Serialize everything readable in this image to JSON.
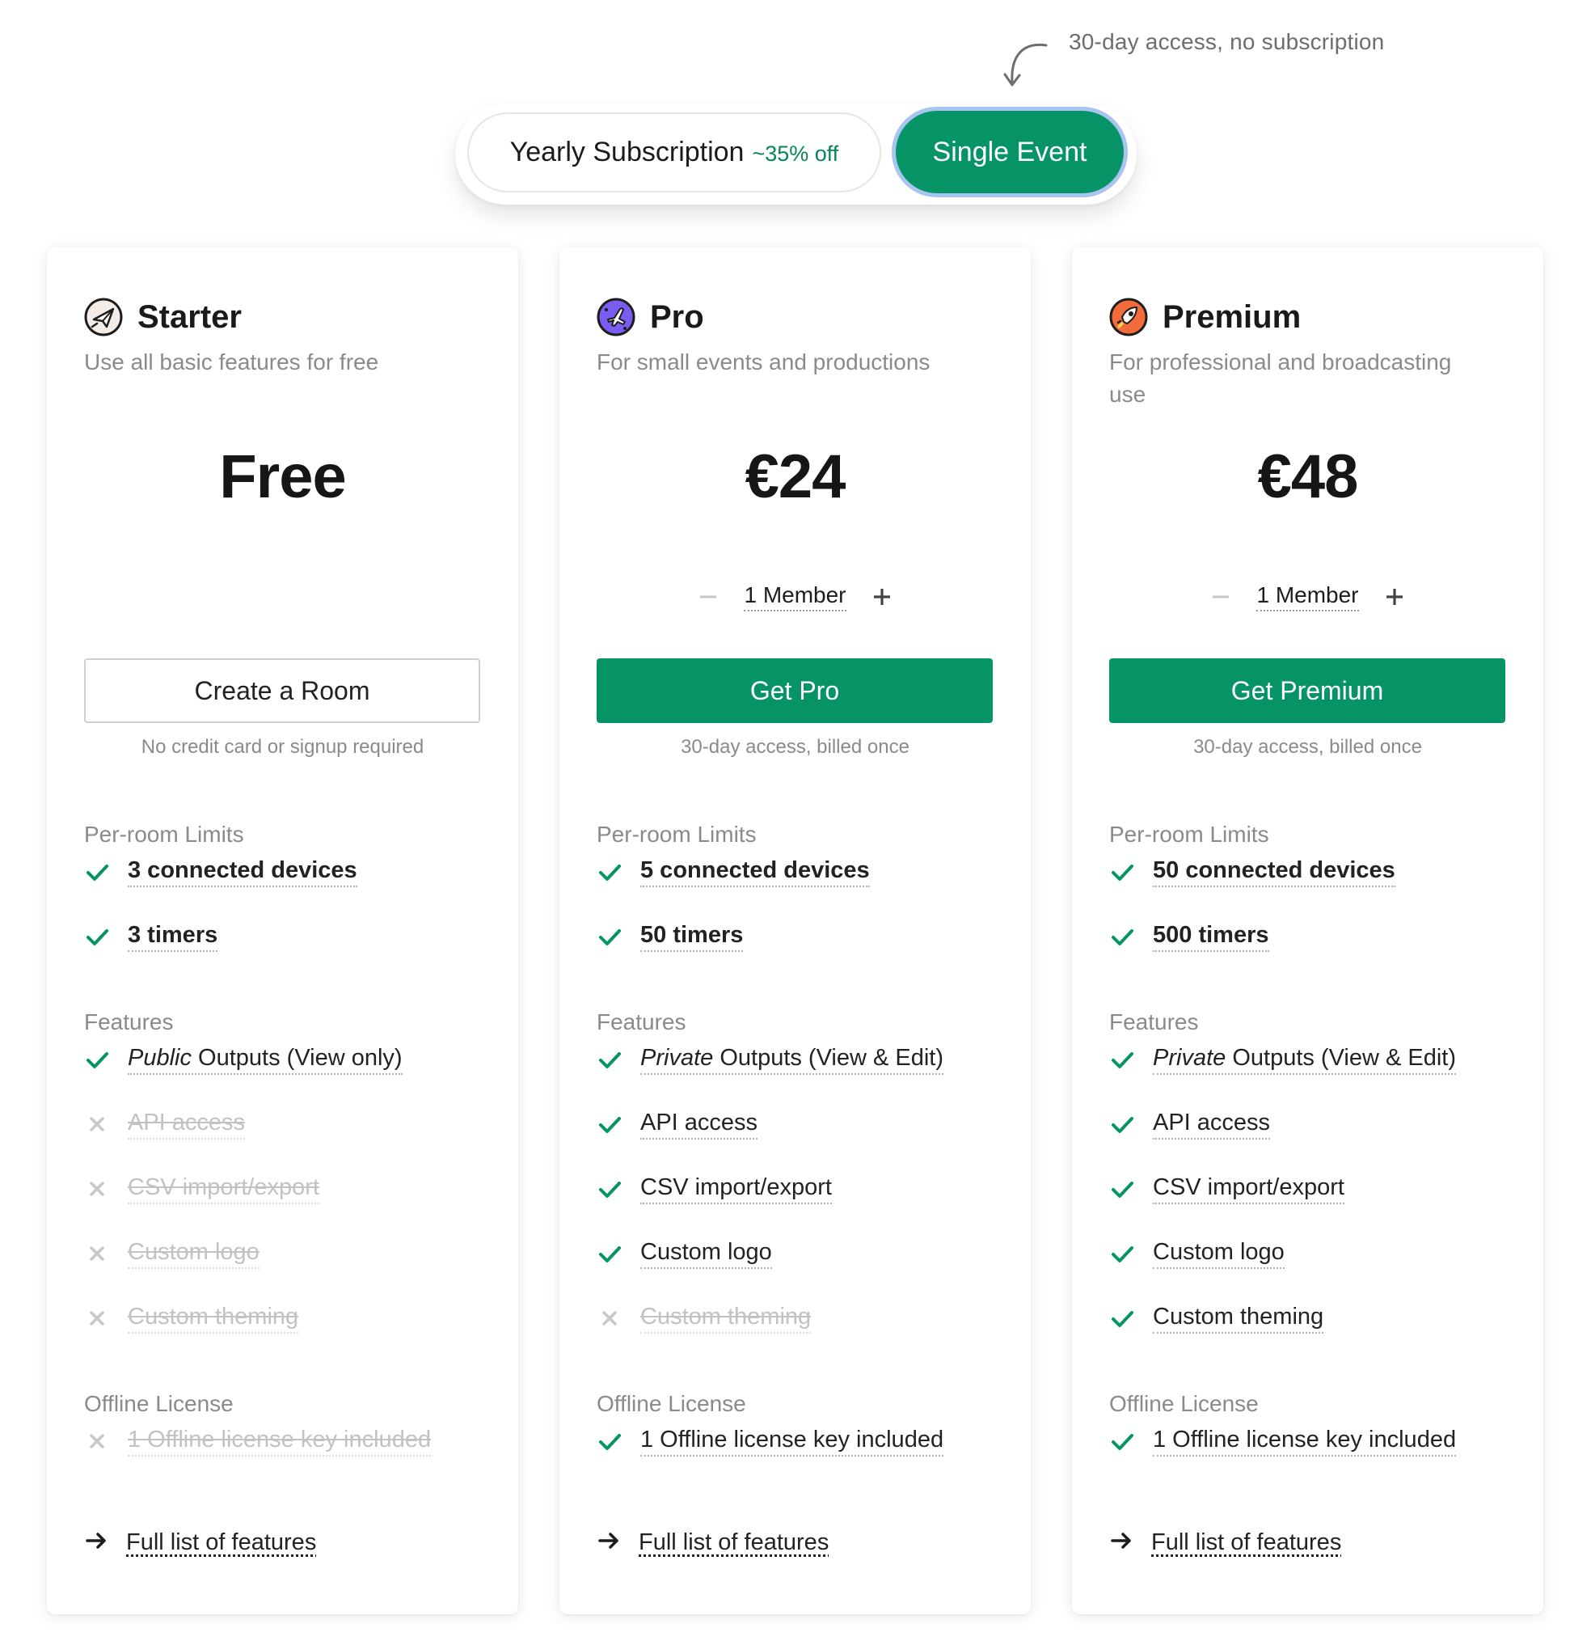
{
  "annotation": {
    "text": "30-day access, no subscription"
  },
  "toggle": {
    "yearly_label": "Yearly Subscription",
    "yearly_discount": "~35% off",
    "single_label": "Single Event",
    "selected": "Single Event"
  },
  "colors": {
    "accent": "#069466",
    "muted": "#8a8a8a",
    "focus_ring": "#a9c4f2"
  },
  "plans": [
    {
      "name": "Starter",
      "icon": "paper-plane-icon",
      "description": "Use all basic features for free",
      "price": "Free",
      "cta": "Create a Room",
      "cta_note": "No credit card or signup required",
      "limits_title": "Per-room Limits",
      "limits": [
        "3 connected devices",
        "3 timers"
      ],
      "features_title": "Features",
      "features": [
        {
          "prefix": "Public",
          "label": " Outputs (View only)",
          "included": true
        },
        {
          "prefix": "",
          "label": "API access",
          "included": false
        },
        {
          "prefix": "",
          "label": "CSV import/export",
          "included": false
        },
        {
          "prefix": "",
          "label": "Custom logo",
          "included": false
        },
        {
          "prefix": "",
          "label": "Custom theming",
          "included": false
        }
      ],
      "offline_title": "Offline License",
      "offline": {
        "label": "1 Offline license key included",
        "included": false
      },
      "full_list": "Full list of features"
    },
    {
      "name": "Pro",
      "icon": "airplane-icon",
      "description": "For small events and productions",
      "price": "€24",
      "members": "1 Member",
      "cta": "Get Pro",
      "cta_note": "30-day access, billed once",
      "limits_title": "Per-room Limits",
      "limits": [
        "5 connected devices",
        "50 timers"
      ],
      "features_title": "Features",
      "features": [
        {
          "prefix": "Private",
          "label": " Outputs (View & Edit)",
          "included": true
        },
        {
          "prefix": "",
          "label": "API access",
          "included": true
        },
        {
          "prefix": "",
          "label": "CSV import/export",
          "included": true
        },
        {
          "prefix": "",
          "label": "Custom logo",
          "included": true
        },
        {
          "prefix": "",
          "label": "Custom theming",
          "included": false
        }
      ],
      "offline_title": "Offline License",
      "offline": {
        "label": "1 Offline license key included",
        "included": true
      },
      "full_list": "Full list of features"
    },
    {
      "name": "Premium",
      "icon": "rocket-icon",
      "description": "For professional and broadcasting use",
      "price": "€48",
      "members": "1 Member",
      "cta": "Get Premium",
      "cta_note": "30-day access, billed once",
      "limits_title": "Per-room Limits",
      "limits": [
        "50 connected devices",
        "500 timers"
      ],
      "features_title": "Features",
      "features": [
        {
          "prefix": "Private",
          "label": " Outputs (View & Edit)",
          "included": true
        },
        {
          "prefix": "",
          "label": "API access",
          "included": true
        },
        {
          "prefix": "",
          "label": "CSV import/export",
          "included": true
        },
        {
          "prefix": "",
          "label": "Custom logo",
          "included": true
        },
        {
          "prefix": "",
          "label": "Custom theming",
          "included": true
        }
      ],
      "offline_title": "Offline License",
      "offline": {
        "label": "1 Offline license key included",
        "included": true
      },
      "full_list": "Full list of features"
    }
  ]
}
